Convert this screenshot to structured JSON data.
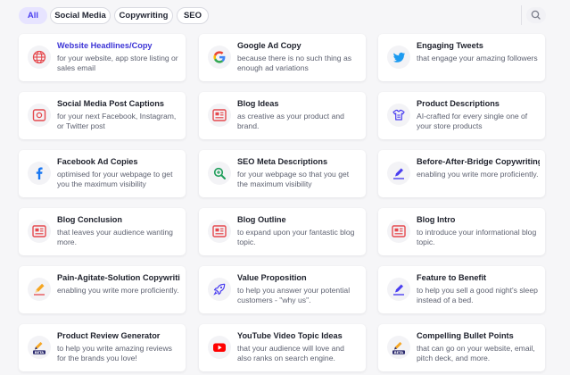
{
  "filters": [
    {
      "label": "All",
      "active": true
    },
    {
      "label": "Social Media",
      "active": false
    },
    {
      "label": "Copywriting",
      "active": false
    },
    {
      "label": "SEO",
      "active": false
    }
  ],
  "search": {
    "icon": "search-icon"
  },
  "templates": [
    {
      "title": "Website Headlines/Copy",
      "desc": "for your website, app store listing or sales email",
      "icon": "globe-icon",
      "highlight": true
    },
    {
      "title": "Google Ad Copy",
      "desc": "because there is no such thing as enough ad variations",
      "icon": "google-icon"
    },
    {
      "title": "Engaging Tweets",
      "desc": "that engage your amazing followers",
      "icon": "twitter-icon"
    },
    {
      "title": "Social Media Post Captions",
      "desc": "for your next Facebook, Instagram, or Twitter post",
      "icon": "image-icon"
    },
    {
      "title": "Blog Ideas",
      "desc": "as creative as your product and brand.",
      "icon": "article-icon"
    },
    {
      "title": "Product Descriptions",
      "desc": "AI-crafted for every single one of your store products",
      "icon": "shirt-icon"
    },
    {
      "title": "Facebook Ad Copies",
      "desc": "optimised for your webpage to get you the maximum visibility",
      "icon": "facebook-icon"
    },
    {
      "title": "SEO Meta Descriptions",
      "desc": "for your webpage so that you get the maximum visibility",
      "icon": "seo-search-icon"
    },
    {
      "title": "Before-After-Bridge Copywriting",
      "desc": "enabling you write more proficiently.",
      "icon": "pen-icon"
    },
    {
      "title": "Blog Conclusion",
      "desc": "that leaves your audience wanting more.",
      "icon": "article-icon"
    },
    {
      "title": "Blog Outline",
      "desc": "to expand upon your fantastic blog topic.",
      "icon": "article-icon"
    },
    {
      "title": "Blog Intro",
      "desc": "to introduce your informational blog topic.",
      "icon": "article-icon"
    },
    {
      "title": "Pain-Agitate-Solution Copywriting",
      "desc": "enabling you write more proficiently.",
      "icon": "pencil-icon"
    },
    {
      "title": "Value Proposition",
      "desc": "to help you answer your potential customers - \"why us\".",
      "icon": "rocket-icon"
    },
    {
      "title": "Feature to Benefit",
      "desc": "to help you sell a good night's sleep instead of a bed.",
      "icon": "pen-icon"
    },
    {
      "title": "Product Review Generator",
      "desc": "to help you write amazing reviews for the brands you love!",
      "icon": "beta-pen-icon",
      "badge": "BETA"
    },
    {
      "title": "YouTube Video Topic Ideas",
      "desc": "that your audience will love and also ranks on search engine.",
      "icon": "youtube-icon"
    },
    {
      "title": "Compelling Bullet Points",
      "desc": "that can go on your website, email, pitch deck, and more.",
      "icon": "beta-pen-icon",
      "badge": "BETA"
    }
  ],
  "colors": {
    "accent": "#4b3ff0",
    "accent_bg": "#e7e4ff",
    "article_red": "#e5484d",
    "google_blue": "#4285f4",
    "twitter_blue": "#1d9bf0",
    "facebook_blue": "#1877f2",
    "youtube_red": "#ff0000"
  }
}
